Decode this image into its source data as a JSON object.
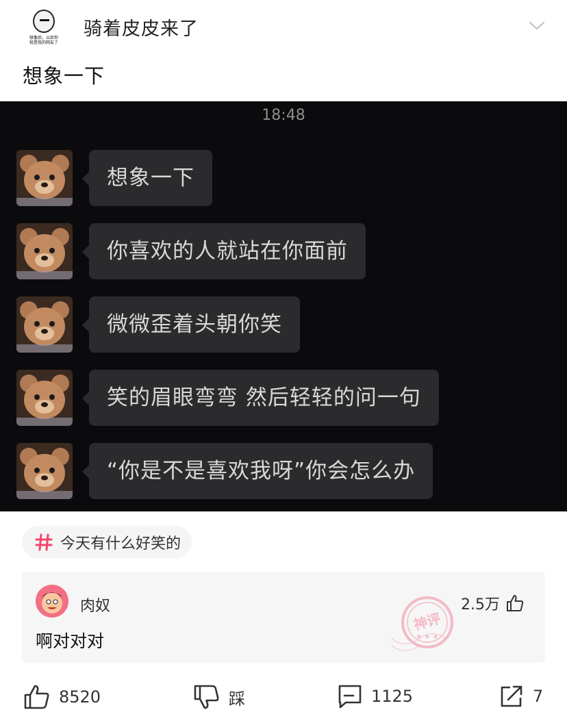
{
  "header": {
    "avatar_caption": "够像后，以后你\n就是我的网友了",
    "username": "骑着皮皮来了",
    "expand_icon": "chevron-down-icon"
  },
  "post": {
    "text": "想象一下"
  },
  "screenshot": {
    "time": "18:48",
    "messages": [
      "想象一下",
      "你喜欢的人就站在你面前",
      "微微歪着头朝你笑",
      "笑的眉眼弯弯 然后轻轻的问一句",
      "“你是不是喜欢我呀”你会怎么办"
    ]
  },
  "topic": {
    "icon": "hashtag-icon",
    "label": "今天有什么好笑的",
    "color": "#f4436a"
  },
  "top_comment": {
    "user": "肉奴",
    "text": "啊对对对",
    "likes": "2.5万",
    "stamp": "神评"
  },
  "actions": {
    "like_count": "8520",
    "dislike_label": "踩",
    "comment_count": "1125",
    "share_count": "7"
  }
}
